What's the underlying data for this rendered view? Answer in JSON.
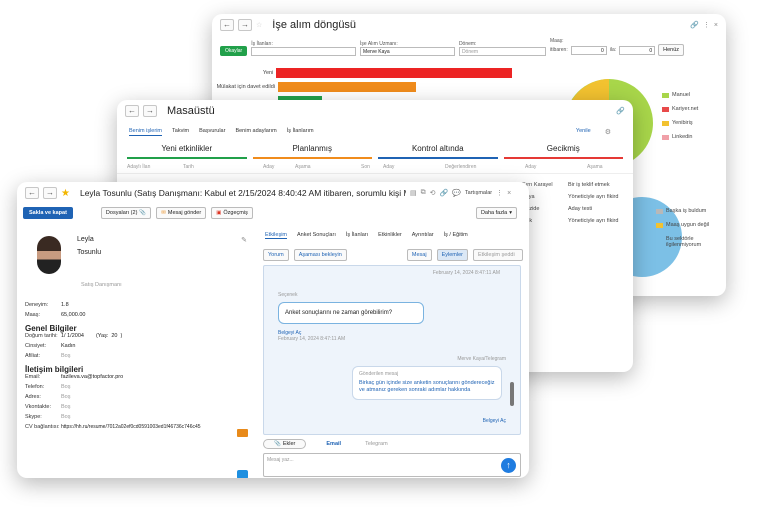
{
  "w1": {
    "title": "İşe alım döngüsü",
    "filters": {
      "f1": "İş İlanları:",
      "f2": "İşe Alım Uzmanı:",
      "f2_value": "Merve Kaya",
      "f3": "Dönem:",
      "f3_value": "Dönem",
      "f4": "Maaş:",
      "f4_from": "itibaren:",
      "f4_to": "ila:",
      "f4_v1": "0",
      "f4_v2": "0",
      "okay": "Okaylar",
      "clear": "Henüz"
    },
    "chart_data": {
      "type": "bar",
      "categories": [
        "Yeni",
        "Mülakat için davet edildi"
      ],
      "values": [
        100,
        57
      ],
      "colors": [
        "#ec2424",
        "#f08c1c"
      ]
    },
    "pie_legend": [
      {
        "label": "Manuel",
        "color": "#a8d64a"
      },
      {
        "label": "Kariyer.net",
        "color": "#e84a4a"
      },
      {
        "label": "Yenibiriş",
        "color": "#f2c230"
      },
      {
        "label": "Linkedin",
        "color": "#f0a0a8"
      }
    ],
    "pie2_legend": [
      {
        "label": "Başka iş buldum",
        "color": "#b8b8b8"
      },
      {
        "label": "Maaş uygun değil",
        "color": "#f2c230"
      },
      {
        "label": "Bu sektörle ilgilenmiyorum",
        "color": "#7cc0e6"
      }
    ]
  },
  "w2": {
    "title": "Masaüstü",
    "tabs": [
      "Benim işlerim",
      "Takvim",
      "Başvurular",
      "Benim adaylarım",
      "İş İlanlarım"
    ],
    "refresh": "Yenile",
    "cols": [
      {
        "label": "Yeni etkinlikler",
        "color": "#21a04a"
      },
      {
        "label": "Planlanmış",
        "color": "#f08c1c"
      },
      {
        "label": "Kontrol altında",
        "color": "#1f63b4"
      },
      {
        "label": "Gecikmiş",
        "color": "#e53935"
      }
    ],
    "subheads": [
      "Adaylı İlan",
      "Tarih",
      "Aday",
      "Aşama",
      "Son",
      "Aday",
      "Değerlendiren",
      "Aday",
      "Aşama"
    ],
    "late_rows": [
      {
        "a": "Sırrı Karayel",
        "b": "Bir iş teklif etmek"
      },
      {
        "a": "Kaya",
        "b": "Yöneticiyle ayrı fikird"
      },
      {
        "a": "Güzide",
        "b": "Aday testi"
      },
      {
        "a": "elek",
        "b": "Yöneticiyle ayrı fikird"
      }
    ]
  },
  "w3": {
    "title": "Leyla Tosunlu (Satış Danışmanı: Kabul et 2/15/2024 8:40:42 AM itibaren, sorumlu kişi Mer...",
    "discuss": "Tartışmalar",
    "save": "Sakla ve kapat",
    "files": "Dosyaları (2)",
    "send_msg": "Mesaj gönder",
    "cv": "Özgeçmiş",
    "more": "Daha fazla",
    "first": "Leyla",
    "last": "Tosunlu",
    "position": "Satış Danışmanı",
    "exp_k": "Deneyim:",
    "exp_v": "1.8",
    "sal_k": "Maaş:",
    "sal_v": "65,000.00",
    "gen": "Genel Bilgiler",
    "dob_k": "Doğum tarihi:",
    "dob_v": "1/ 1/2004",
    "age_k": "(Yaş:",
    "age_v": "20",
    ")": ")",
    "sex_k": "Cinsiyet:",
    "sex_v": "Kadın",
    "aff_k": "Afiliat:",
    "aff_v": "Boş",
    "contact": "İletişim bilgileri",
    "email_k": "Email:",
    "email_v": "fazileva.va@topfactor.pro",
    "tel_k": "Telefon:",
    "tel_v": "Boş",
    "addr_k": "Adres:",
    "addr_v": "Boş",
    "vk_k": "Vkontakte:",
    "vk_v": "Boş",
    "skype_k": "Skype:",
    "skype_v": "Boş",
    "cvl_k": "CV bağlantısı:",
    "cvl_v": "https://hh.ru/resume/7012a02ef0cd0591003ed1f46736c746c45",
    "tabs": [
      "Etkileşim",
      "Anket Sonuçları",
      "İş İlanları",
      "Etkinlikler",
      "Ayrıntılar",
      "İş / Eğitim"
    ],
    "bar_btn1": "Yorum",
    "bar_btn2": "Aşaması bekleyin",
    "f_msg": "Mesaj",
    "f_evt": "Eylemler",
    "f_ph": "Etkileşim şeddi",
    "ts0": "February 14, 2024 8:47:11 AM",
    "m1_from": "Seçenek",
    "m1_text": "Anket sonuçlarını ne zaman görebilirim?",
    "m1_meta": "Belgeyi Aç",
    "m1_ts": "February 14, 2024 8:47:11 AM",
    "m2_hdr": "Merve Kaya/Telegram",
    "m2_from": "Gönderilen mesaj",
    "m2_text": "Birkaç gün içinde size anketin sonuçlarını göndereceğiz ve atmanız gereken sonraki adımlar hakkında",
    "m2_link": "Belgeyi Aç",
    "ch_btn": "Ekler",
    "ch_email": "Email",
    "ch_tg": "Telegram",
    "ph": "Mesaj yaz..."
  }
}
